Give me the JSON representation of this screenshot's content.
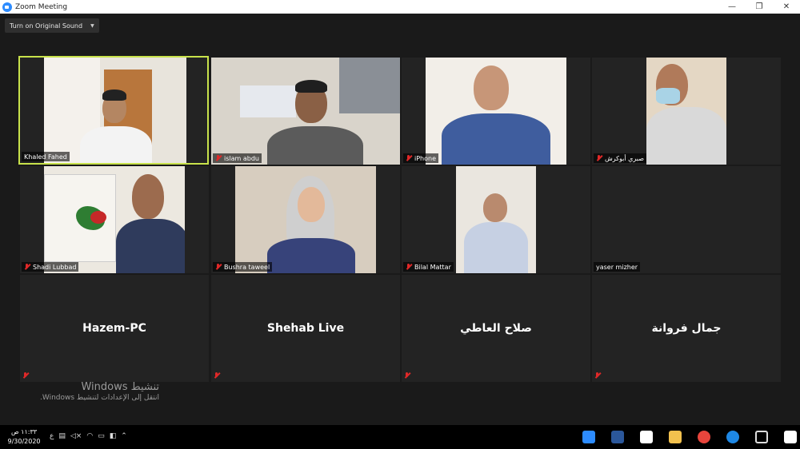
{
  "window": {
    "title": "Zoom Meeting",
    "controls": [
      "—",
      "❐",
      "✕"
    ]
  },
  "audio_button": {
    "label": "Turn on Original Sound"
  },
  "participants": [
    {
      "name": "Khaled Fahed",
      "active": true,
      "muted": false
    },
    {
      "name": "islam abdu",
      "muted": true
    },
    {
      "name": "iPhone",
      "muted": true
    },
    {
      "name": "صبري أبوكرش",
      "muted": true
    },
    {
      "name": "Shadi Lubbad",
      "muted": true
    },
    {
      "name": "Bushra taweel",
      "muted": true
    },
    {
      "name": "Bilal Mattar",
      "muted": true
    },
    {
      "name": "yaser mizher",
      "muted": false
    },
    {
      "name": "Hazem-PC",
      "muted": true
    },
    {
      "name": "Shehab Live",
      "muted": true
    },
    {
      "name": "صلاح العاطي",
      "muted": true
    },
    {
      "name": "جمال فروانة",
      "muted": true
    }
  ],
  "activation": {
    "line1": "تنشيط Windows",
    "line2": "انتقل إلى الإعدادات لتنشيط Windows."
  },
  "taskbar": {
    "time": "١١:٣٣ ص",
    "date": "9/30/2020",
    "lang": "ع",
    "apps": [
      {
        "icon": "zoom-icon",
        "color": "#2d8cff"
      },
      {
        "icon": "word-icon",
        "color": "#2b579a"
      },
      {
        "icon": "store-icon",
        "color": "#ffffff"
      },
      {
        "icon": "file-explorer-icon",
        "color": "#f2c14e"
      },
      {
        "icon": "chrome-icon",
        "color": "#e8453c"
      },
      {
        "icon": "edge-icon",
        "color": "#1e88e5"
      },
      {
        "icon": "tablet-icon",
        "color": "#dddddd"
      },
      {
        "icon": "windows-icon",
        "color": "#ffffff"
      }
    ]
  }
}
